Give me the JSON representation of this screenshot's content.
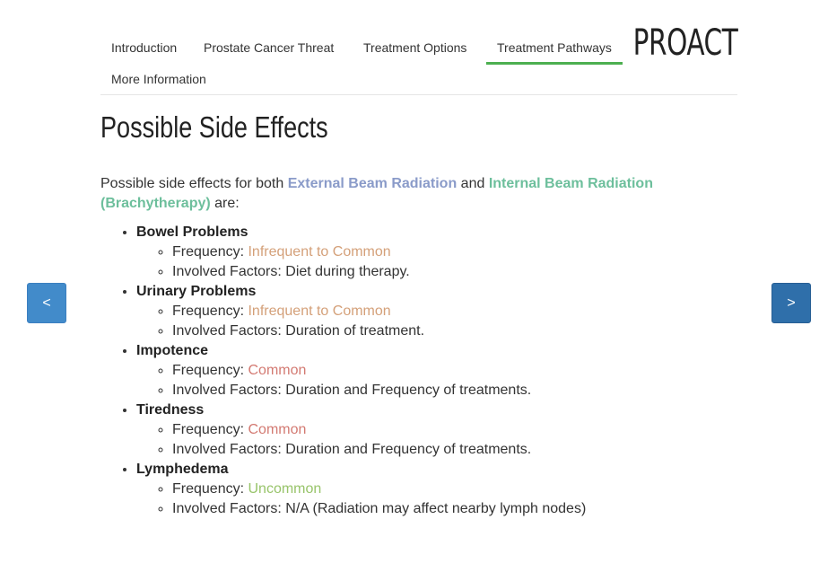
{
  "nav": {
    "items": [
      {
        "label": "Introduction"
      },
      {
        "label": "Prostate Cancer Threat"
      },
      {
        "label": "Treatment Options"
      },
      {
        "label": "Treatment Pathways",
        "active": true
      },
      {
        "label": "More Information"
      }
    ],
    "brand": "PROACT",
    "active_color": "#4caf50"
  },
  "page": {
    "title": "Possible Side Effects",
    "intro_prefix": "Possible side effects for both ",
    "external_label": "External Beam Radiation",
    "intro_and": " and ",
    "internal_label": "Internal Beam Radiation (Brachytherapy)",
    "intro_suffix": " are:",
    "frequency_prefix": "Frequency: ",
    "factors_prefix": "Involved Factors: "
  },
  "side_effects": [
    {
      "name": "Bowel Problems",
      "frequency": "Infrequent to Common",
      "factors": "Diet during therapy."
    },
    {
      "name": "Urinary Problems",
      "frequency": "Infrequent to Common",
      "factors": "Duration of treatment."
    },
    {
      "name": "Impotence",
      "frequency": "Common",
      "factors": "Duration and Frequency of treatments."
    },
    {
      "name": "Tiredness",
      "frequency": "Common",
      "factors": "Duration and Frequency of treatments."
    },
    {
      "name": "Lymphedema",
      "frequency": "Uncommon",
      "factors": "N/A (Radiation may affect nearby lymph nodes)"
    }
  ],
  "controls": {
    "prev_label": "<",
    "next_label": ">"
  },
  "colors": {
    "external": "#8a9bc9",
    "internal": "#6dbf9c",
    "infrequent_to_common": "#d4a079",
    "common": "#d37a72",
    "uncommon": "#98c46a",
    "prev_button": "#428bca",
    "next_button": "#2f6faa"
  }
}
